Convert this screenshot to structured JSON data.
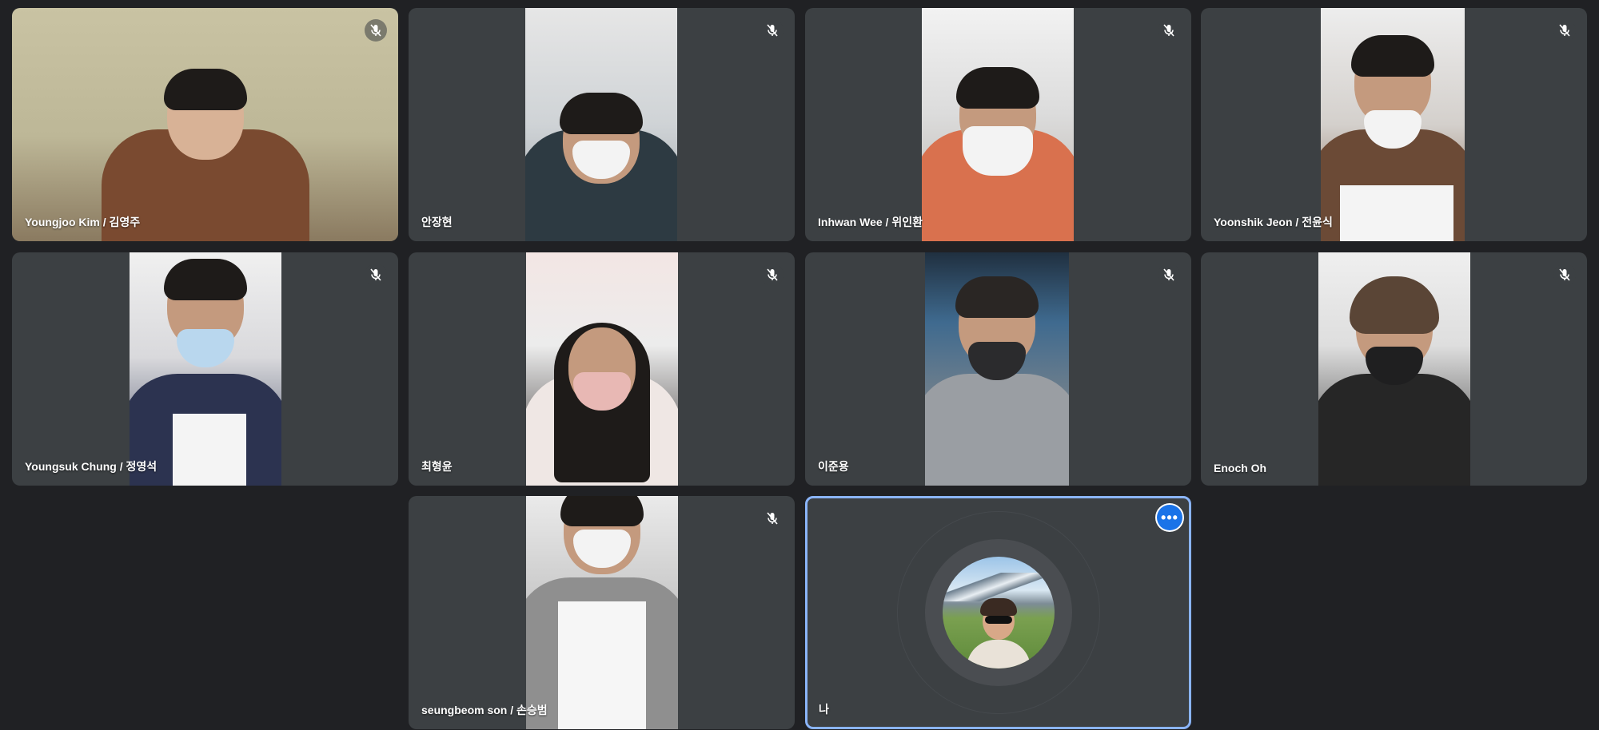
{
  "participants": [
    {
      "name": "Youngjoo Kim / 김영주",
      "muted": true
    },
    {
      "name": "안장현",
      "muted": true
    },
    {
      "name": "Inhwan Wee / 위인환",
      "muted": true
    },
    {
      "name": "Yoonshik Jeon / 전윤식",
      "muted": true
    },
    {
      "name": "Youngsuk Chung / 정영석",
      "muted": true
    },
    {
      "name": "최형윤",
      "muted": true
    },
    {
      "name": "이준용",
      "muted": true
    },
    {
      "name": "Enoch Oh",
      "muted": true
    },
    {
      "name": "seungbeom son / 손승범",
      "muted": true
    },
    {
      "name": "나",
      "muted": false
    }
  ],
  "self_tile": {
    "more_button": "•••",
    "accent": "#8ab4f8",
    "button_color": "#1a73e8"
  },
  "icons": {
    "mic_off": "mic-off-icon",
    "more": "more-options-icon"
  },
  "colors": {
    "background": "#202124",
    "tile": "#3c4043"
  }
}
